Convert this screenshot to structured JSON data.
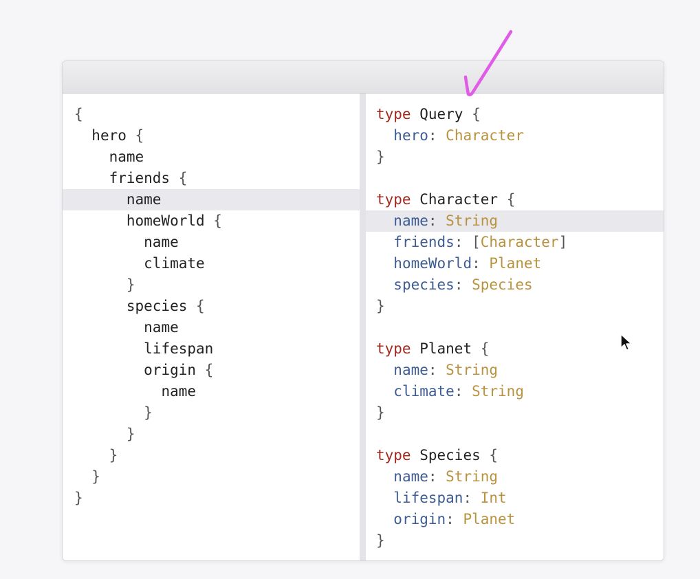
{
  "query": {
    "lines": [
      {
        "text": "{",
        "indent": 0,
        "highlight": false
      },
      {
        "text": "hero {",
        "indent": 1,
        "highlight": false
      },
      {
        "text": "name",
        "indent": 2,
        "highlight": false
      },
      {
        "text": "friends {",
        "indent": 2,
        "highlight": false
      },
      {
        "text": "name",
        "indent": 3,
        "highlight": true
      },
      {
        "text": "homeWorld {",
        "indent": 3,
        "highlight": false
      },
      {
        "text": "name",
        "indent": 4,
        "highlight": false
      },
      {
        "text": "climate",
        "indent": 4,
        "highlight": false
      },
      {
        "text": "}",
        "indent": 3,
        "highlight": false
      },
      {
        "text": "species {",
        "indent": 3,
        "highlight": false
      },
      {
        "text": "name",
        "indent": 4,
        "highlight": false
      },
      {
        "text": "lifespan",
        "indent": 4,
        "highlight": false
      },
      {
        "text": "origin {",
        "indent": 4,
        "highlight": false
      },
      {
        "text": "name",
        "indent": 5,
        "highlight": false
      },
      {
        "text": "}",
        "indent": 4,
        "highlight": false
      },
      {
        "text": "}",
        "indent": 3,
        "highlight": false
      },
      {
        "text": "}",
        "indent": 2,
        "highlight": false
      },
      {
        "text": "}",
        "indent": 1,
        "highlight": false
      },
      {
        "text": "}",
        "indent": 0,
        "highlight": false
      }
    ]
  },
  "schema": {
    "lines": [
      {
        "kind": "type_open",
        "keyword": "type",
        "name": "Query",
        "brace": "{"
      },
      {
        "kind": "field",
        "field": "hero",
        "type": "Character"
      },
      {
        "kind": "close",
        "brace": "}"
      },
      {
        "kind": "blank"
      },
      {
        "kind": "type_open",
        "keyword": "type",
        "name": "Character",
        "brace": "{"
      },
      {
        "kind": "field",
        "field": "name",
        "type": "String",
        "highlight": true
      },
      {
        "kind": "field",
        "field": "friends",
        "type": "Character",
        "list": true
      },
      {
        "kind": "field",
        "field": "homeWorld",
        "type": "Planet"
      },
      {
        "kind": "field",
        "field": "species",
        "type": "Species"
      },
      {
        "kind": "close",
        "brace": "}"
      },
      {
        "kind": "blank"
      },
      {
        "kind": "type_open",
        "keyword": "type",
        "name": "Planet",
        "brace": "{"
      },
      {
        "kind": "field",
        "field": "name",
        "type": "String"
      },
      {
        "kind": "field",
        "field": "climate",
        "type": "String"
      },
      {
        "kind": "close",
        "brace": "}"
      },
      {
        "kind": "blank"
      },
      {
        "kind": "type_open",
        "keyword": "type",
        "name": "Species",
        "brace": "{"
      },
      {
        "kind": "field",
        "field": "name",
        "type": "String"
      },
      {
        "kind": "field",
        "field": "lifespan",
        "type": "Int"
      },
      {
        "kind": "field",
        "field": "origin",
        "type": "Planet"
      },
      {
        "kind": "close",
        "brace": "}"
      }
    ]
  },
  "colors": {
    "keyword": "#a3281e",
    "field": "#3d5c93",
    "field_type": "#b8923d",
    "highlight_bg": "#e8e8ed",
    "annotation": "#e05ce6"
  },
  "icons": {
    "annotation": "checkmark-annotation-icon",
    "cursor": "mouse-pointer-icon"
  }
}
